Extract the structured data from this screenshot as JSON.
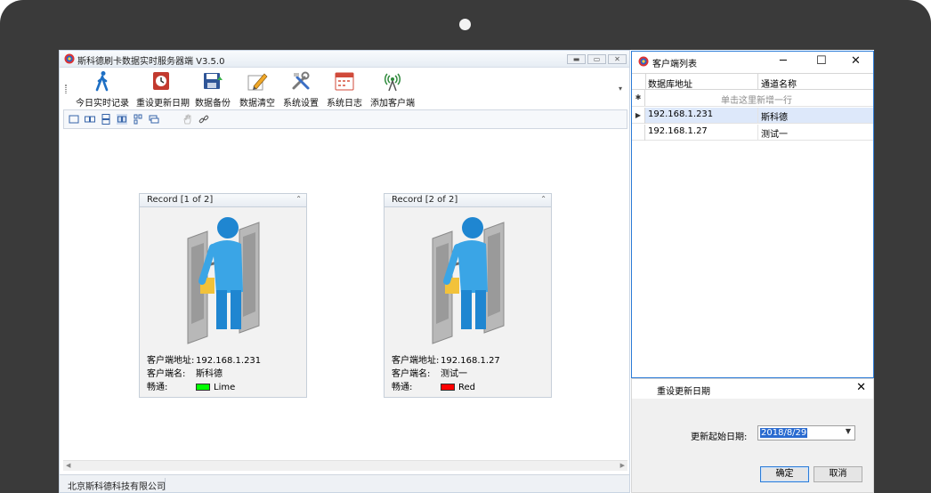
{
  "main_window": {
    "title": "斯科德刷卡数据实时服务器端 V3.5.0",
    "controls": {
      "minimize": "▬",
      "restore": "▭",
      "close": "✕"
    },
    "toolbar": [
      {
        "label": "今日实时记录",
        "icon": "walking-person-icon"
      },
      {
        "label": "重设更新日期",
        "icon": "alarm-clock-icon"
      },
      {
        "label": "数据备份",
        "icon": "save-disk-icon"
      },
      {
        "label": "数据清空",
        "icon": "eraser-pencil-icon"
      },
      {
        "label": "系统设置",
        "icon": "tools-icon"
      },
      {
        "label": "系统日志",
        "icon": "calendar-log-icon"
      },
      {
        "label": "添加客户端",
        "icon": "antenna-icon"
      }
    ],
    "records": [
      {
        "title": "Record [1 of 2]",
        "address_label": "客户端地址:",
        "address": "192.168.1.231",
        "name_label": "客户端名:",
        "name": "斯科德",
        "status_label": "畅通:",
        "status_color_name": "Lime",
        "status_color": "#00ff00"
      },
      {
        "title": "Record [2 of 2]",
        "address_label": "客户端地址:",
        "address": "192.168.1.27",
        "name_label": "客户端名:",
        "name": "测试一",
        "status_label": "畅通:",
        "status_color_name": "Red",
        "status_color": "#ff0000"
      }
    ],
    "status_bar": "北京斯科德科技有限公司"
  },
  "client_list": {
    "title": "客户端列表",
    "columns": [
      "数据库地址",
      "通道名称"
    ],
    "new_row_hint": "单击这里新增一行",
    "rows": [
      {
        "address": "192.168.1.231",
        "channel": "斯科德",
        "selected": true
      },
      {
        "address": "192.168.1.27",
        "channel": "测试一",
        "selected": false
      }
    ]
  },
  "reset_dialog": {
    "title": "重设更新日期",
    "label": "更新起始日期:",
    "date_value": "2018/8/29",
    "ok_label": "确定",
    "cancel_label": "取消"
  }
}
